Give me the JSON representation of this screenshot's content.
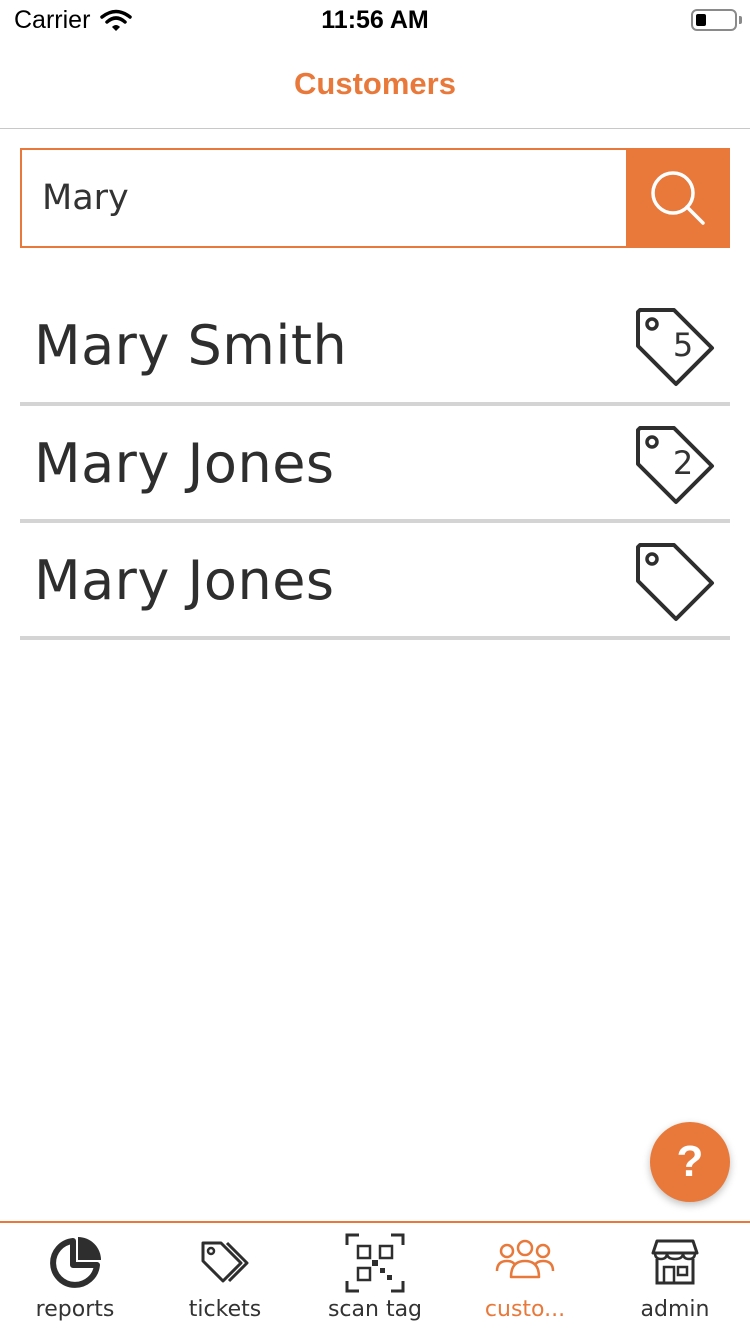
{
  "status_bar": {
    "carrier": "Carrier",
    "time": "11:56 AM"
  },
  "nav": {
    "title": "Customers"
  },
  "search": {
    "value": "Mary",
    "placeholder": ""
  },
  "customers": [
    {
      "name": "Mary Smith",
      "tag_count": "5"
    },
    {
      "name": "Mary Jones",
      "tag_count": "2"
    },
    {
      "name": "Mary Jones",
      "tag_count": ""
    }
  ],
  "help": {
    "label": "?"
  },
  "tabs": [
    {
      "label": "reports",
      "icon": "pie-chart-icon",
      "active": false
    },
    {
      "label": "tickets",
      "icon": "tags-icon",
      "active": false
    },
    {
      "label": "scan tag",
      "icon": "qr-code-icon",
      "active": false
    },
    {
      "label": "custo...",
      "icon": "users-icon",
      "active": true
    },
    {
      "label": "admin",
      "icon": "store-icon",
      "active": false
    }
  ],
  "colors": {
    "accent": "#e8793a",
    "text": "#333333",
    "divider": "#d4d4d4"
  }
}
